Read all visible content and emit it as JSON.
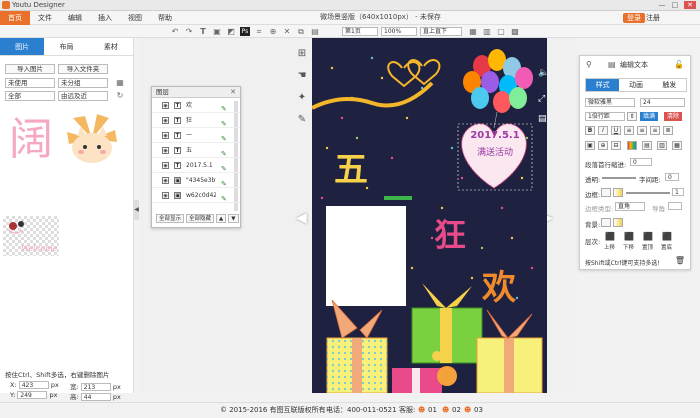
{
  "app": {
    "title": "Youtu Designer",
    "window_controls": [
      "—",
      "□",
      "✕"
    ]
  },
  "menu": {
    "items": [
      "首页",
      "文件",
      "编辑",
      "插入",
      "视图",
      "帮助"
    ],
    "active": 0
  },
  "document": {
    "title": "微场景竖版（640x1010px） - 未保存"
  },
  "account": {
    "login": "登录",
    "register": "注册"
  },
  "toolbar": {
    "page_select": "第1页",
    "zoom_select": "100%",
    "align_select": "直上直下"
  },
  "left_panel": {
    "tabs": [
      "图片",
      "布局",
      "素材"
    ],
    "active_tab": 0,
    "import_image": "导入图片",
    "import_folder": "导入文件夹",
    "filter_used": "未使用",
    "filter_group": "未分组",
    "filter_all": "全部",
    "sort_order": "由远及近",
    "thumb_welcome": "Welcome",
    "hint": "按住Ctrl、Shift多选，右键删除图片",
    "x_label": "X:",
    "x_value": "423",
    "x_unit": "px",
    "w_label": "宽:",
    "w_value": "213",
    "w_unit": "px",
    "y_label": "Y:",
    "y_value": "249",
    "y_unit": "px",
    "h_label": "高:",
    "h_value": "44",
    "h_unit": "px"
  },
  "layers_panel": {
    "title": "图层",
    "rows": [
      "欢",
      "狂",
      "一",
      "五",
      "2017.5.1",
      "\"4345e3bf...",
      "w62c0d42e..."
    ],
    "show_all": "全部显示",
    "hide_all": "全部隐藏"
  },
  "poster": {
    "date": "2017.5.1",
    "event": "满送活动",
    "char_five": "五",
    "char_crazy": "狂",
    "char_joy": "欢"
  },
  "right_panel": {
    "title": "编辑文本",
    "tabs": [
      "样式",
      "动画",
      "触发"
    ],
    "active_tab": 0,
    "font_family": "微软雅黑",
    "font_size": "24",
    "line_height": "1倍行距",
    "btn_apply": "填满",
    "btn_clear": "清除",
    "indent_label": "段落首行缩进:",
    "indent_value": "0",
    "opacity_label": "透明:",
    "letter_spacing_label": "字间距:",
    "letter_spacing_value": "0",
    "border_label": "边框:",
    "border_value": "1",
    "border_type_label": "边框类型:",
    "border_type_value": "直角",
    "radius_label": "导角",
    "bg_label": "背景:",
    "layer_label": "层次:",
    "layer_buttons": [
      "上移",
      "下移",
      "置顶",
      "置底"
    ],
    "hint": "按Shift或Ctrl键可支持多选!"
  },
  "footer": {
    "copyright": "© 2015-2016 有图互联版权所有",
    "phone": "电话：400-011-0521",
    "service": "客服:",
    "service_1": "01",
    "service_2": "02",
    "service_3": "03"
  },
  "colors": {
    "accent": "#e8702a",
    "blue": "#2a7fcf",
    "poster_bg": "#1f2140"
  }
}
